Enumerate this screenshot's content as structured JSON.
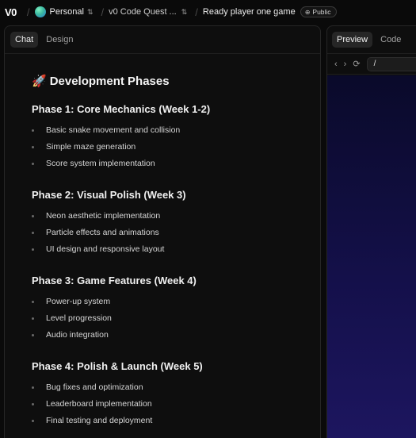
{
  "topbar": {
    "logo": "V0",
    "workspace": "Personal",
    "project": "v0 Code Quest ...",
    "page_title": "Ready player one game",
    "visibility": "Public",
    "visibility_icon": "globe-icon",
    "chevron_icon": "chevron-updown-icon"
  },
  "chat": {
    "tabs": [
      "Chat",
      "Design"
    ],
    "active_tab": "Chat",
    "heading_icon": "🚀",
    "heading": "Development Phases",
    "phases": [
      {
        "title": "Phase 1: Core Mechanics (Week 1-2)",
        "items": [
          "Basic snake movement and collision",
          "Simple maze generation",
          "Score system implementation"
        ]
      },
      {
        "title": "Phase 2: Visual Polish (Week 3)",
        "items": [
          "Neon aesthetic implementation",
          "Particle effects and animations",
          "UI design and responsive layout"
        ]
      },
      {
        "title": "Phase 3: Game Features (Week 4)",
        "items": [
          "Power-up system",
          "Level progression",
          "Audio integration"
        ]
      },
      {
        "title": "Phase 4: Polish & Launch (Week 5)",
        "items": [
          "Bug fixes and optimization",
          "Leaderboard implementation",
          "Final testing and deployment"
        ]
      }
    ]
  },
  "preview": {
    "tabs": [
      "Preview",
      "Code"
    ],
    "active_tab": "Preview",
    "url": "/",
    "screen_colors": [
      "#0a0a2a",
      "#1d1660"
    ]
  }
}
